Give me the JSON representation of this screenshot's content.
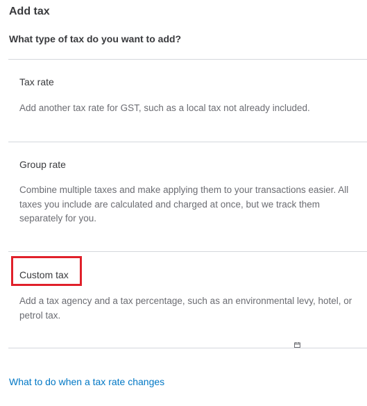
{
  "header": {
    "title": "Add tax",
    "question": "What type of tax do you want to add?"
  },
  "options": [
    {
      "title": "Tax rate",
      "description": "Add another tax rate for GST, such as a local tax not already included."
    },
    {
      "title": "Group rate",
      "description": "Combine multiple taxes and make applying them to your transactions easier. All taxes you include are calculated and charged at once, but we track them separately for you."
    },
    {
      "title": "Custom tax",
      "description": "Add a tax agency and a tax percentage, such as an environmental levy, hotel, or petrol tax."
    }
  ],
  "footer": {
    "link": "What to do when a tax rate changes"
  },
  "colors": {
    "highlight": "#e0202a",
    "link": "#0077c5",
    "divider": "#d4d7dc"
  },
  "icons": {
    "small_icon": "calendar-icon"
  }
}
